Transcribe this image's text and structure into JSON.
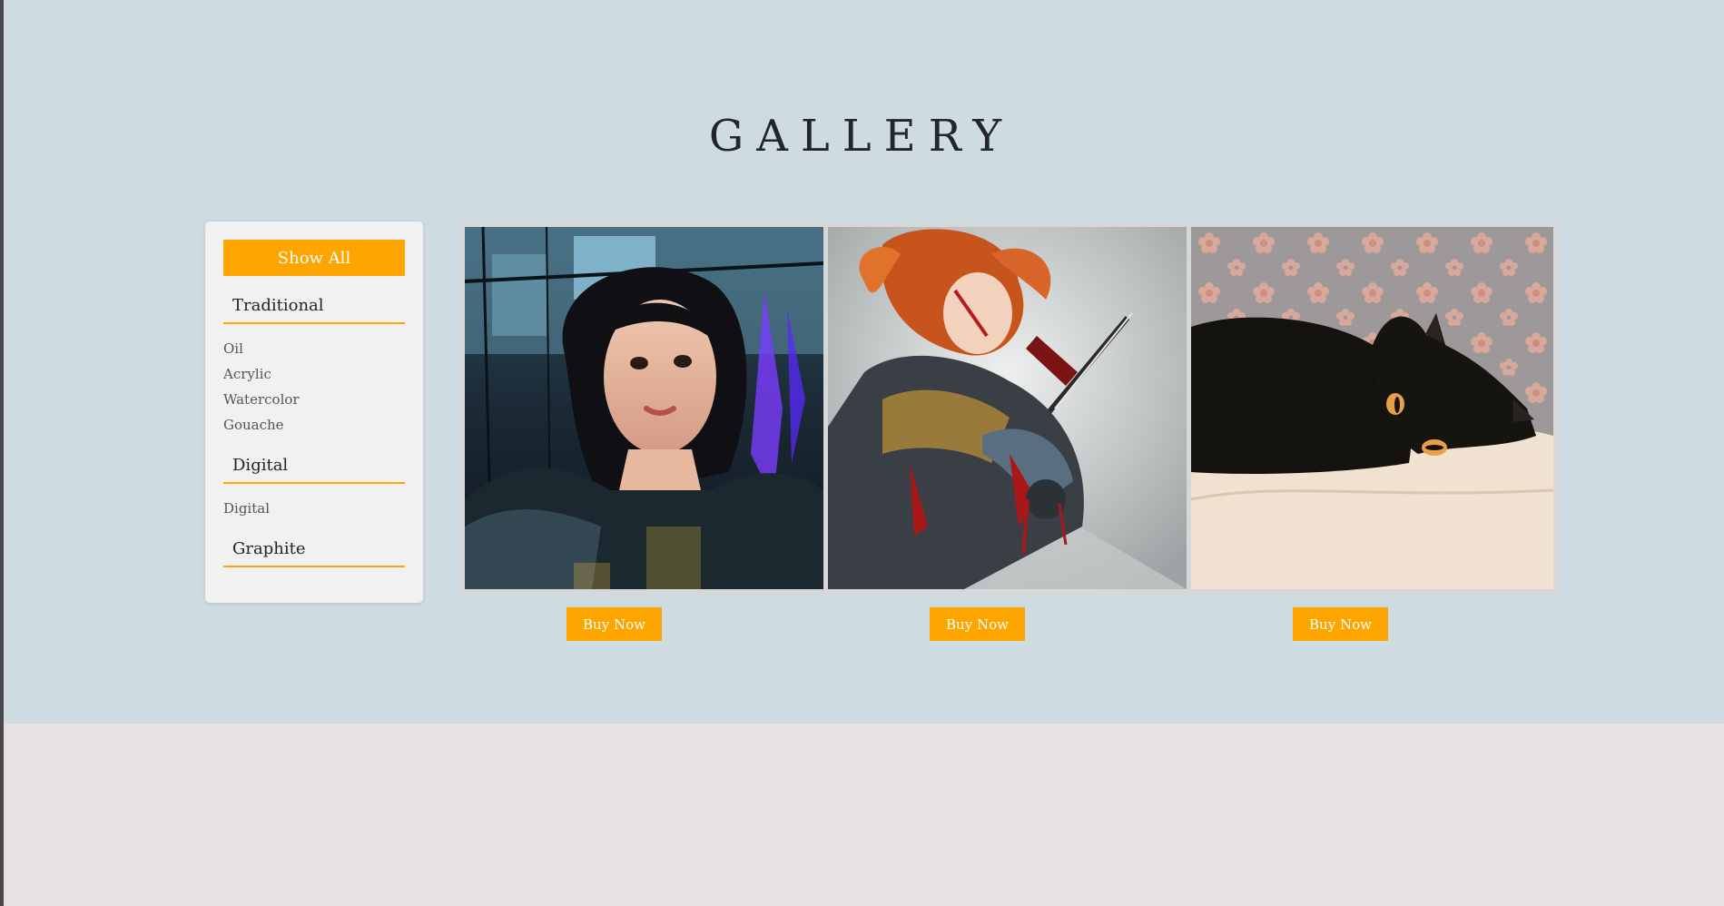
{
  "page": {
    "title": "GALLERY",
    "colors": {
      "accent": "#ffa500",
      "hero_background": "#cedbe1",
      "footer_background": "#e6e2e1",
      "sidebar_background": "#f1f1f1"
    }
  },
  "sidebar": {
    "show_all_label": "Show All",
    "categories": [
      {
        "label": "Traditional",
        "items": [
          "Oil",
          "Acrylic",
          "Watercolor",
          "Gouache"
        ]
      },
      {
        "label": "Digital",
        "items": [
          "Digital"
        ]
      },
      {
        "label": "Graphite",
        "items": []
      }
    ]
  },
  "gallery": {
    "items": [
      {
        "image": "portrait-woman-in-car-painting",
        "buy_label": "Buy Now"
      },
      {
        "image": "armored-red-haired-warrior-painting",
        "buy_label": "Buy Now"
      },
      {
        "image": "black-cat-on-bed-painting",
        "buy_label": "Buy Now"
      }
    ]
  }
}
